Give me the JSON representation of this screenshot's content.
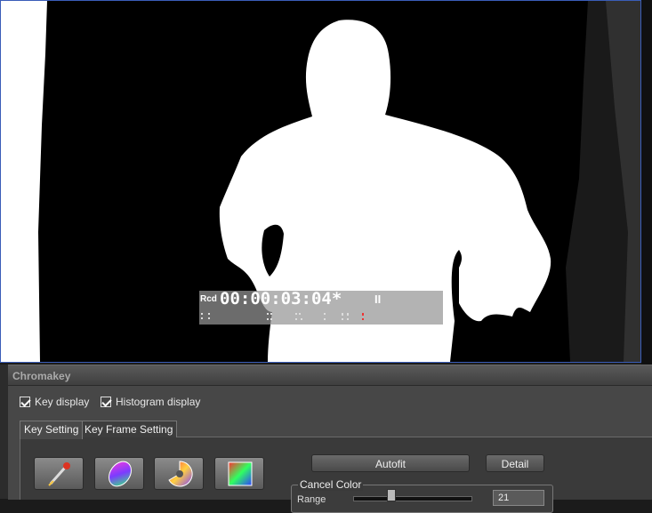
{
  "preview": {
    "timecode_label": "Rcd",
    "timecode": "00:00:03:04",
    "timecode_marker": "*",
    "pause_symbol": "II"
  },
  "panel": {
    "title": "Chromakey",
    "key_display_label": "Key display",
    "histogram_display_label": "Histogram display",
    "tabs": [
      {
        "label": "Key Setting",
        "active": true
      },
      {
        "label": "Key Frame Setting",
        "active": false
      }
    ],
    "tools": [
      {
        "icon": "eyedropper-icon"
      },
      {
        "icon": "color-ellipse-icon"
      },
      {
        "icon": "color-wheel-icon"
      },
      {
        "icon": "color-square-icon"
      }
    ],
    "autofit_label": "Autofit",
    "detail_label": "Detail",
    "cancel_color_label": "Cancel Color",
    "range_label": "Range",
    "range_value": "21"
  }
}
